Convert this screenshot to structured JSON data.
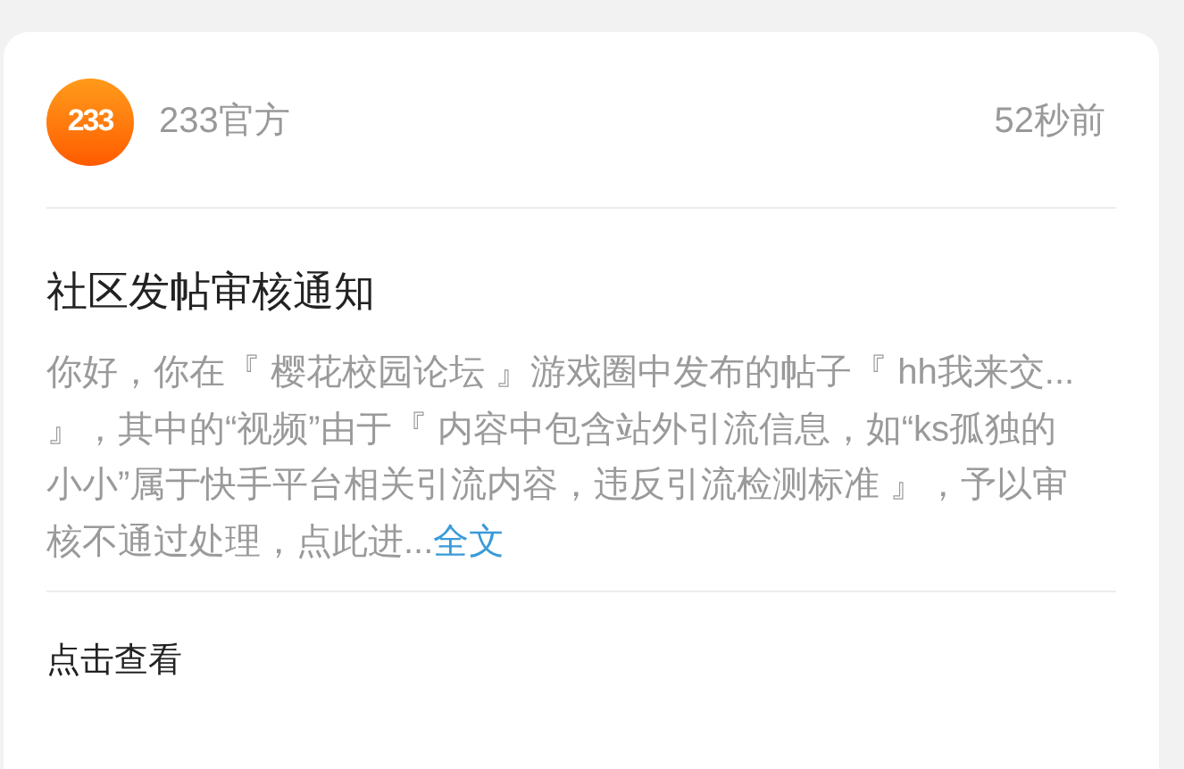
{
  "sender": {
    "logo": "233",
    "name": "233官方",
    "time": "52秒前"
  },
  "notice": {
    "title": "社区发帖审核通知",
    "body": "你好，你在『 樱花校园论坛 』游戏圈中发布的帖子『 hh我来交... 』，其中的“视频”由于『 内容中包含站外引流信息，如“ks孤独的小小”属于快手平台相关引流内容，违反引流检测标准 』，予以审核不通过处理，点此进...",
    "link": "全文"
  },
  "footer": {
    "action": "点击查看"
  }
}
